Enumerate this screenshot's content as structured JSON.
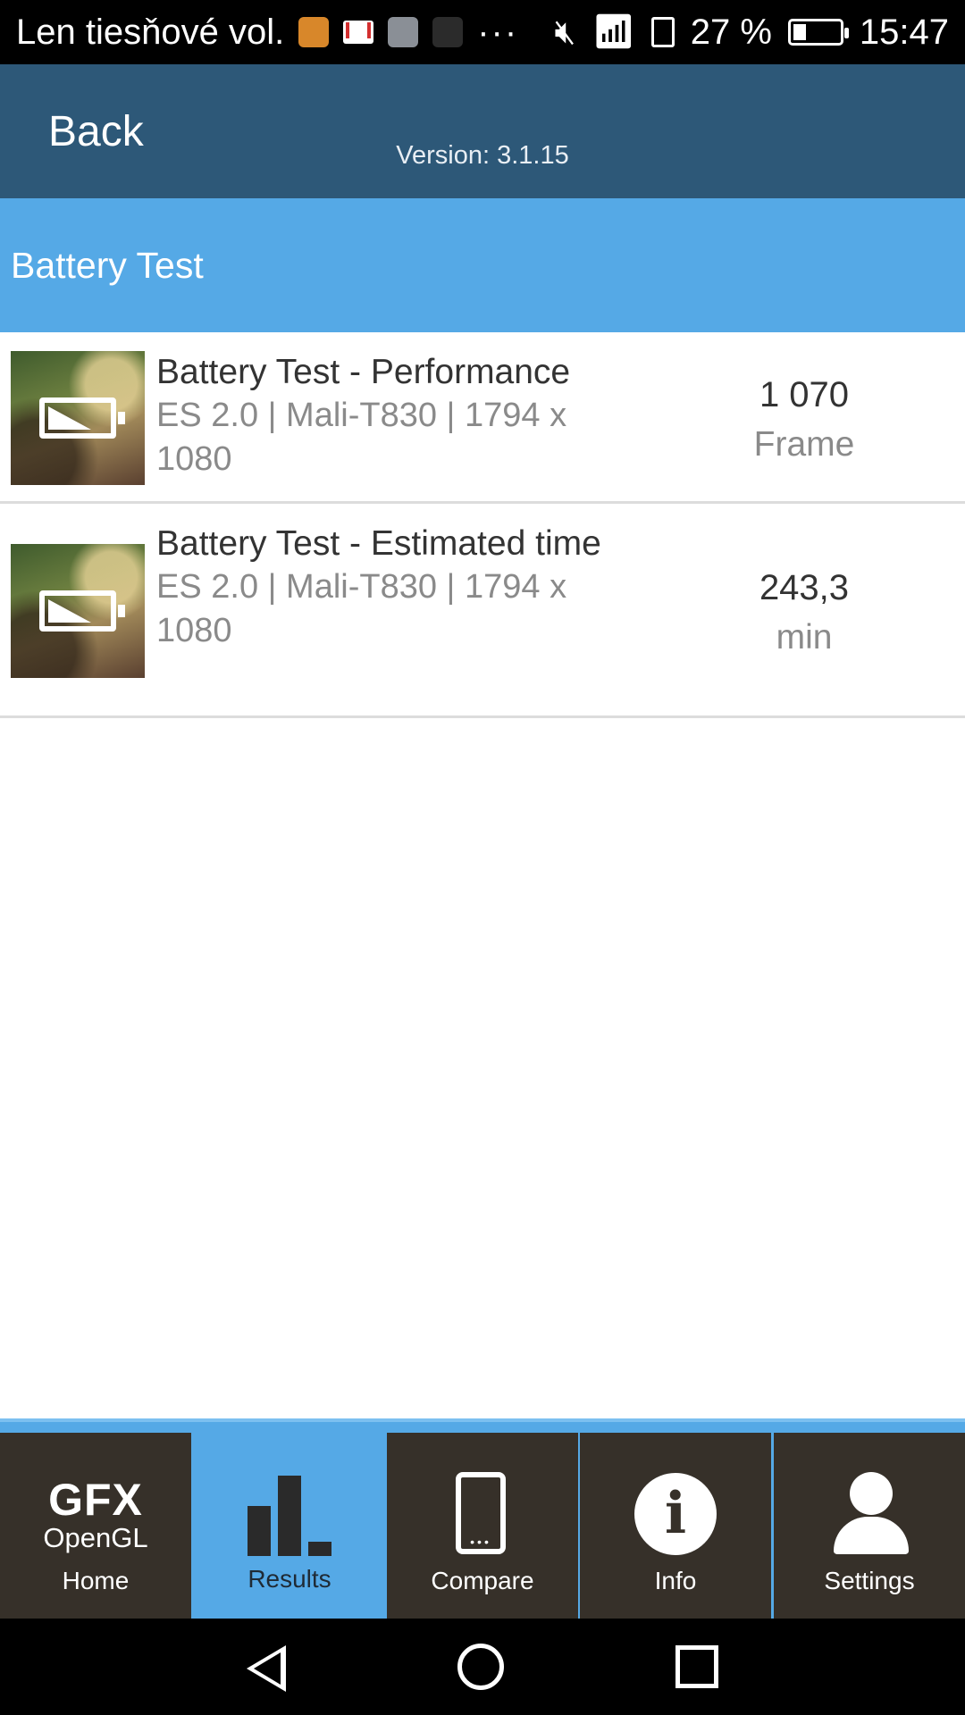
{
  "status_bar": {
    "carrier": "Len tiesňové vol.",
    "more": "···",
    "battery_percent": "27 %",
    "time": "15:47"
  },
  "header": {
    "back_label": "Back",
    "version": "Version: 3.1.15"
  },
  "section": {
    "title": "Battery Test"
  },
  "results": [
    {
      "title": "Battery Test - Performance",
      "subtitle": "ES 2.0 | Mali-T830 | 1794 x 1080",
      "value": "1 070",
      "unit": "Frame"
    },
    {
      "title": "Battery Test - Estimated time",
      "subtitle": "ES 2.0 | Mali-T830 | 1794 x 1080",
      "value": "243,3",
      "unit": "min"
    }
  ],
  "nav": {
    "logo_line1": "GFX",
    "logo_line2": "OpenGL",
    "tabs": [
      {
        "label": "Home",
        "icon": "gfx-logo-icon"
      },
      {
        "label": "Results",
        "icon": "bar-chart-icon",
        "active": true
      },
      {
        "label": "Compare",
        "icon": "phone-icon"
      },
      {
        "label": "Info",
        "icon": "info-icon"
      },
      {
        "label": "Settings",
        "icon": "user-icon"
      }
    ]
  },
  "colors": {
    "header_bg": "#2d5878",
    "accent_blue": "#55a9e6",
    "nav_dark": "#363029"
  }
}
